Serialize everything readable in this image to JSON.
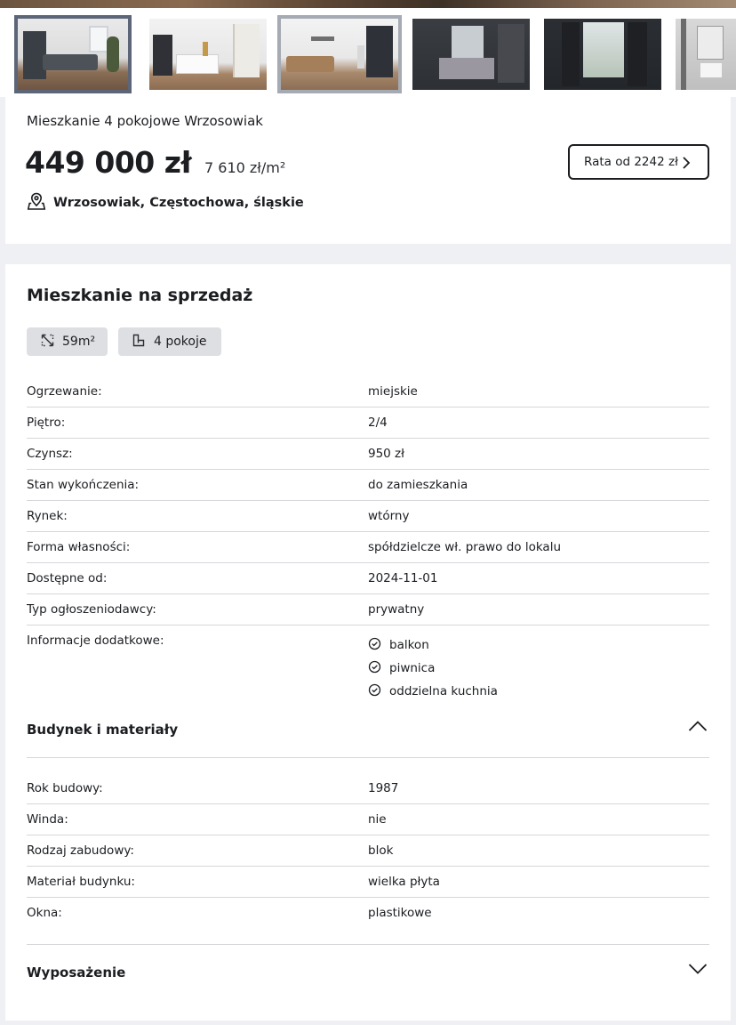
{
  "gallery": {
    "thumbnails": [
      {
        "alt": "salon z sofą"
      },
      {
        "alt": "pokój z komodą"
      },
      {
        "alt": "salon z kanapą"
      },
      {
        "alt": "sypialnia"
      },
      {
        "alt": "pokój z oknem"
      },
      {
        "alt": "łazienka"
      }
    ]
  },
  "listing": {
    "title": "Mieszkanie 4 pokojowe Wrzosowiak",
    "price": "449 000 zł",
    "price_per_m2": "7 610 zł/m²",
    "location": "Wrzosowiak, Częstochowa, śląskie",
    "installment_button": "Rata od 2242 zł"
  },
  "details": {
    "heading": "Mieszkanie na sprzedaż",
    "chips": {
      "area": "59m²",
      "rooms": "4 pokoje"
    },
    "rows": [
      {
        "label": "Ogrzewanie:",
        "value": "miejskie"
      },
      {
        "label": "Piętro:",
        "value": "2/4"
      },
      {
        "label": "Czynsz:",
        "value": "950 zł"
      },
      {
        "label": "Stan wykończenia:",
        "value": "do zamieszkania"
      },
      {
        "label": "Rynek:",
        "value": "wtórny"
      },
      {
        "label": "Forma własności:",
        "value": "spółdzielcze wł. prawo do lokalu"
      },
      {
        "label": "Dostępne od:",
        "value": "2024-11-01"
      },
      {
        "label": "Typ ogłoszeniodawcy:",
        "value": "prywatny"
      }
    ],
    "extras_label": "Informacje dodatkowe:",
    "extras": [
      "balkon",
      "piwnica",
      "oddzielna kuchnia"
    ]
  },
  "building": {
    "heading": "Budynek i materiały",
    "rows": [
      {
        "label": "Rok budowy:",
        "value": "1987"
      },
      {
        "label": "Winda:",
        "value": "nie"
      },
      {
        "label": "Rodzaj zabudowy:",
        "value": "blok"
      },
      {
        "label": "Materiał budynku:",
        "value": "wielka płyta"
      },
      {
        "label": "Okna:",
        "value": "plastikowe"
      }
    ]
  },
  "equipment": {
    "heading": "Wyposażenie"
  }
}
